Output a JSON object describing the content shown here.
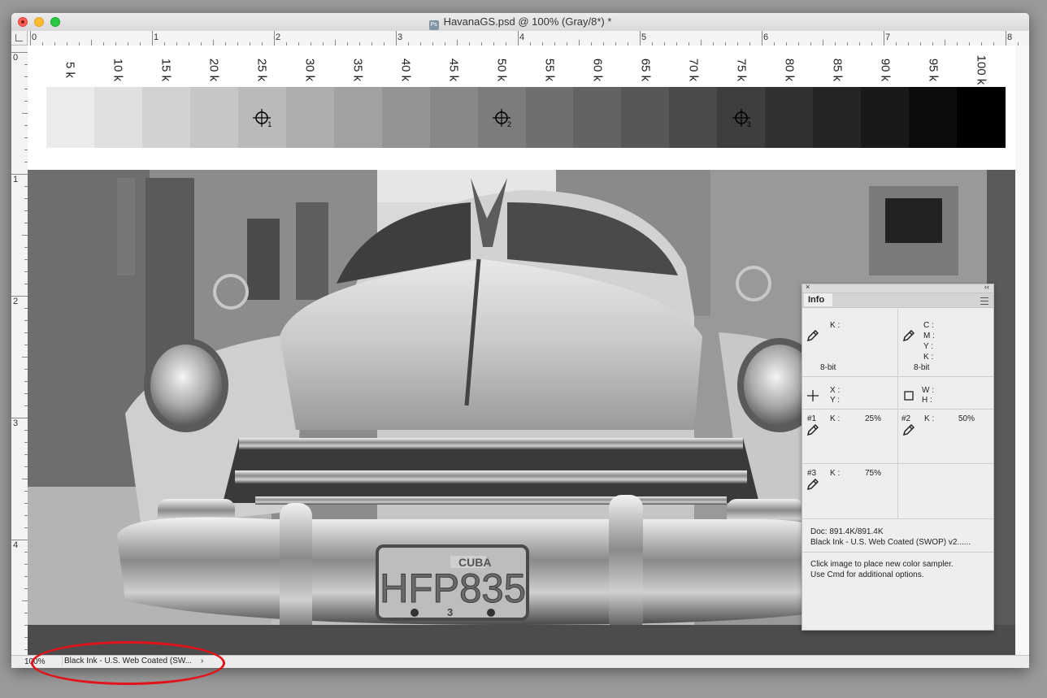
{
  "window": {
    "title": "HavanaGS.psd @ 100% (Gray/8*) *",
    "app_icon_text": "Ps"
  },
  "rulers": {
    "horizontal_labels": [
      "0",
      "1",
      "2",
      "3",
      "4",
      "5",
      "6",
      "7",
      "8"
    ],
    "vertical_labels": [
      "0",
      "1",
      "2",
      "3",
      "4"
    ]
  },
  "grayscale_scale": {
    "labels": [
      "5 k",
      "10 k",
      "15 k",
      "20 k",
      "25 k",
      "30 k",
      "35 k",
      "40 k",
      "45 k",
      "50 k",
      "55 k",
      "60 k",
      "65 k",
      "70 k",
      "75 k",
      "80 k",
      "85 k",
      "90 k",
      "95 k",
      "100 k"
    ],
    "percent_values": [
      5,
      10,
      15,
      20,
      25,
      30,
      35,
      40,
      45,
      50,
      55,
      60,
      65,
      70,
      75,
      80,
      85,
      90,
      95,
      100
    ],
    "samplers": [
      {
        "number": "1",
        "patch_index": 4
      },
      {
        "number": "2",
        "patch_index": 9
      },
      {
        "number": "3",
        "patch_index": 14
      }
    ]
  },
  "photo": {
    "plate_top": "CUBA",
    "plate_number": "HFP835",
    "plate_bottom": "3"
  },
  "info_panel": {
    "tab_label": "Info",
    "close_glyph": "×",
    "collapse_glyph": "‹‹",
    "readout1": {
      "k_label": "K :",
      "bitdepth": "8-bit"
    },
    "readout2": {
      "c_label": "C :",
      "m_label": "M :",
      "y_label": "Y :",
      "k_label": "K :",
      "bitdepth": "8-bit"
    },
    "position": {
      "x_label": "X :",
      "y_label": "Y :"
    },
    "size": {
      "w_label": "W :",
      "h_label": "H :"
    },
    "samplers": [
      {
        "id": "#1",
        "channel": "K :",
        "value": "25%"
      },
      {
        "id": "#2",
        "channel": "K :",
        "value": "50%"
      },
      {
        "id": "#3",
        "channel": "K :",
        "value": "75%"
      }
    ],
    "doc_size": "Doc: 891.4K/891.4K",
    "profile": "Black Ink - U.S. Web Coated (SWOP) v2......",
    "hint_line1": "Click image to place new color sampler.",
    "hint_line2": "Use Cmd for additional options."
  },
  "status_bar": {
    "zoom": "100%",
    "document_profile": "Black Ink - U.S. Web Coated (SW...",
    "chevron": "›"
  },
  "colors": {
    "annotation_ellipse": "#e0141a"
  }
}
